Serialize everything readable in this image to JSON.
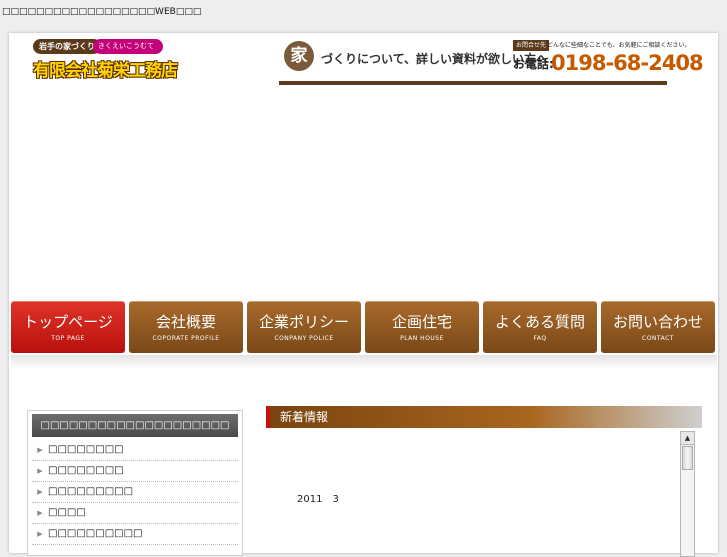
{
  "topline": "□□□□□□□□□□□□□□□□□□WEB□□□",
  "logo": {
    "tagline": "岩手の家づくり",
    "kana": "きくえいこうむてん",
    "name": "有限会社菊栄工務店"
  },
  "banner": {
    "ie": "家",
    "message": "づくりについて、詳しい資料が欲しい方へ",
    "inquiry": "お問合せ先",
    "note": "どんなに些細なことでも、お気軽にご相談ください。",
    "tel_label": "お電話:",
    "tel": "0198-68-2408"
  },
  "nav": [
    {
      "jp": "トップページ",
      "en": "TOP PAGE"
    },
    {
      "jp": "会社概要",
      "en": "COPORATE PROFILE"
    },
    {
      "jp": "企業ポリシー",
      "en": "CONPANY POLICE"
    },
    {
      "jp": "企画住宅",
      "en": "PLAN HOUSE"
    },
    {
      "jp": "よくある質問",
      "en": "FAQ"
    },
    {
      "jp": "お問い合わせ",
      "en": "CONTACT"
    }
  ],
  "sidebar": {
    "heading": "□□□□□□□□□□□□□□□□□□□□",
    "items": [
      "□□□□□□□□",
      "□□□□□□□□",
      "□□□□□□□□□",
      "□□□□",
      "□□□□□□□□□□"
    ]
  },
  "news": {
    "title": "新着情報",
    "entry": "2011　3"
  },
  "colors": {
    "nav_active": "#c8100c",
    "nav_default": "#8a5420",
    "news_accent": "#c8100c",
    "tel": "#c55a00"
  }
}
